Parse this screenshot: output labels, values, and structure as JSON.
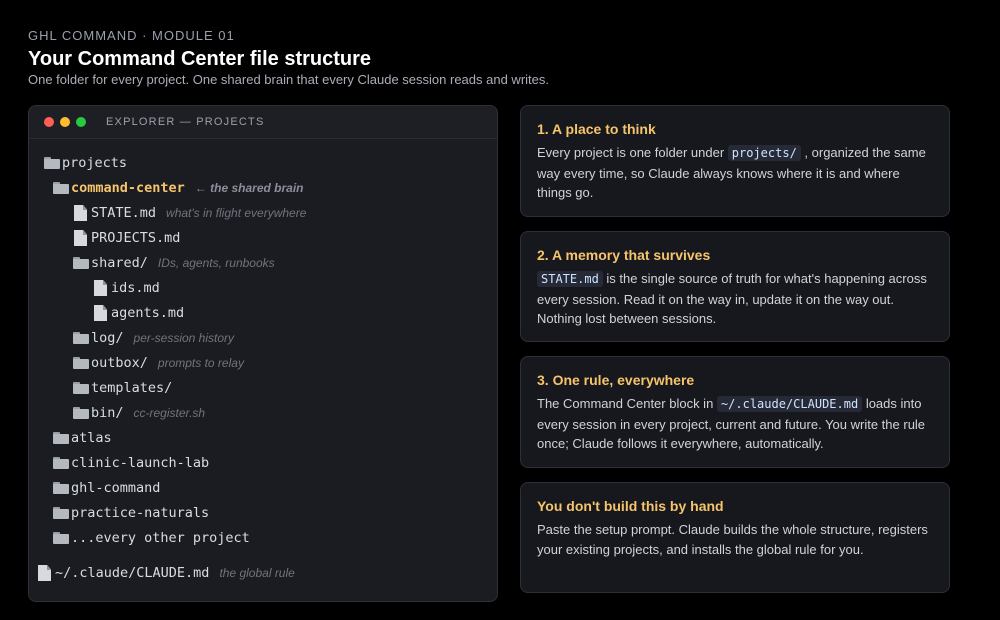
{
  "header": {
    "eyebrow": "GHL COMMAND · MODULE 01",
    "title": "Your Command Center file structure",
    "subtitle": "One folder for every project. One shared brain that every Claude session reads and writes."
  },
  "explorer": {
    "label": "EXPLORER — PROJECTS",
    "items": [
      {
        "type": "folder",
        "name": "projects",
        "note": ""
      },
      {
        "type": "folder",
        "name": "command-center",
        "note": "← the shared brain",
        "highlight": true
      },
      {
        "type": "file",
        "name": "STATE.md",
        "note": "what's in flight everywhere"
      },
      {
        "type": "file",
        "name": "PROJECTS.md",
        "note": ""
      },
      {
        "type": "folder",
        "name": "shared/",
        "note": "IDs, agents, runbooks"
      },
      {
        "type": "file",
        "name": "ids.md",
        "note": ""
      },
      {
        "type": "file",
        "name": "agents.md",
        "note": ""
      },
      {
        "type": "folder",
        "name": "log/",
        "note": "per-session history"
      },
      {
        "type": "folder",
        "name": "outbox/",
        "note": "prompts to relay"
      },
      {
        "type": "folder",
        "name": "templates/",
        "note": ""
      },
      {
        "type": "folder",
        "name": "bin/",
        "note": "cc-register.sh"
      },
      {
        "type": "folder",
        "name": "atlas",
        "note": ""
      },
      {
        "type": "folder",
        "name": "clinic-launch-lab",
        "note": ""
      },
      {
        "type": "folder",
        "name": "ghl-command",
        "note": ""
      },
      {
        "type": "folder",
        "name": "practice-naturals",
        "note": ""
      },
      {
        "type": "folder",
        "name": "...every other project",
        "note": ""
      },
      {
        "type": "file",
        "name": "~/.claude/CLAUDE.md",
        "note": "the global rule"
      }
    ]
  },
  "cards": [
    {
      "title": "1. A place to think",
      "before": "Every project is one folder under ",
      "code": "projects/",
      "after": " , organized the same way every time, so Claude always knows where it is and where things go."
    },
    {
      "title": "2. A memory that survives",
      "before": "",
      "code": "STATE.md",
      "after": " is the single source of truth for what's happening across every session. Read it on the way in, update it on the way out. Nothing lost between sessions."
    },
    {
      "title": "3. One rule, everywhere",
      "before": "The Command Center block in ",
      "code": "~/.claude/CLAUDE.md",
      "after": " loads into every session in every project, current and future. You write the rule once; Claude follows it everywhere, automatically."
    },
    {
      "title": "You don't build this by hand",
      "before": "Paste the setup prompt. Claude builds the whole structure, registers your existing projects, and installs the global rule for you.",
      "code": "",
      "after": ""
    }
  ]
}
